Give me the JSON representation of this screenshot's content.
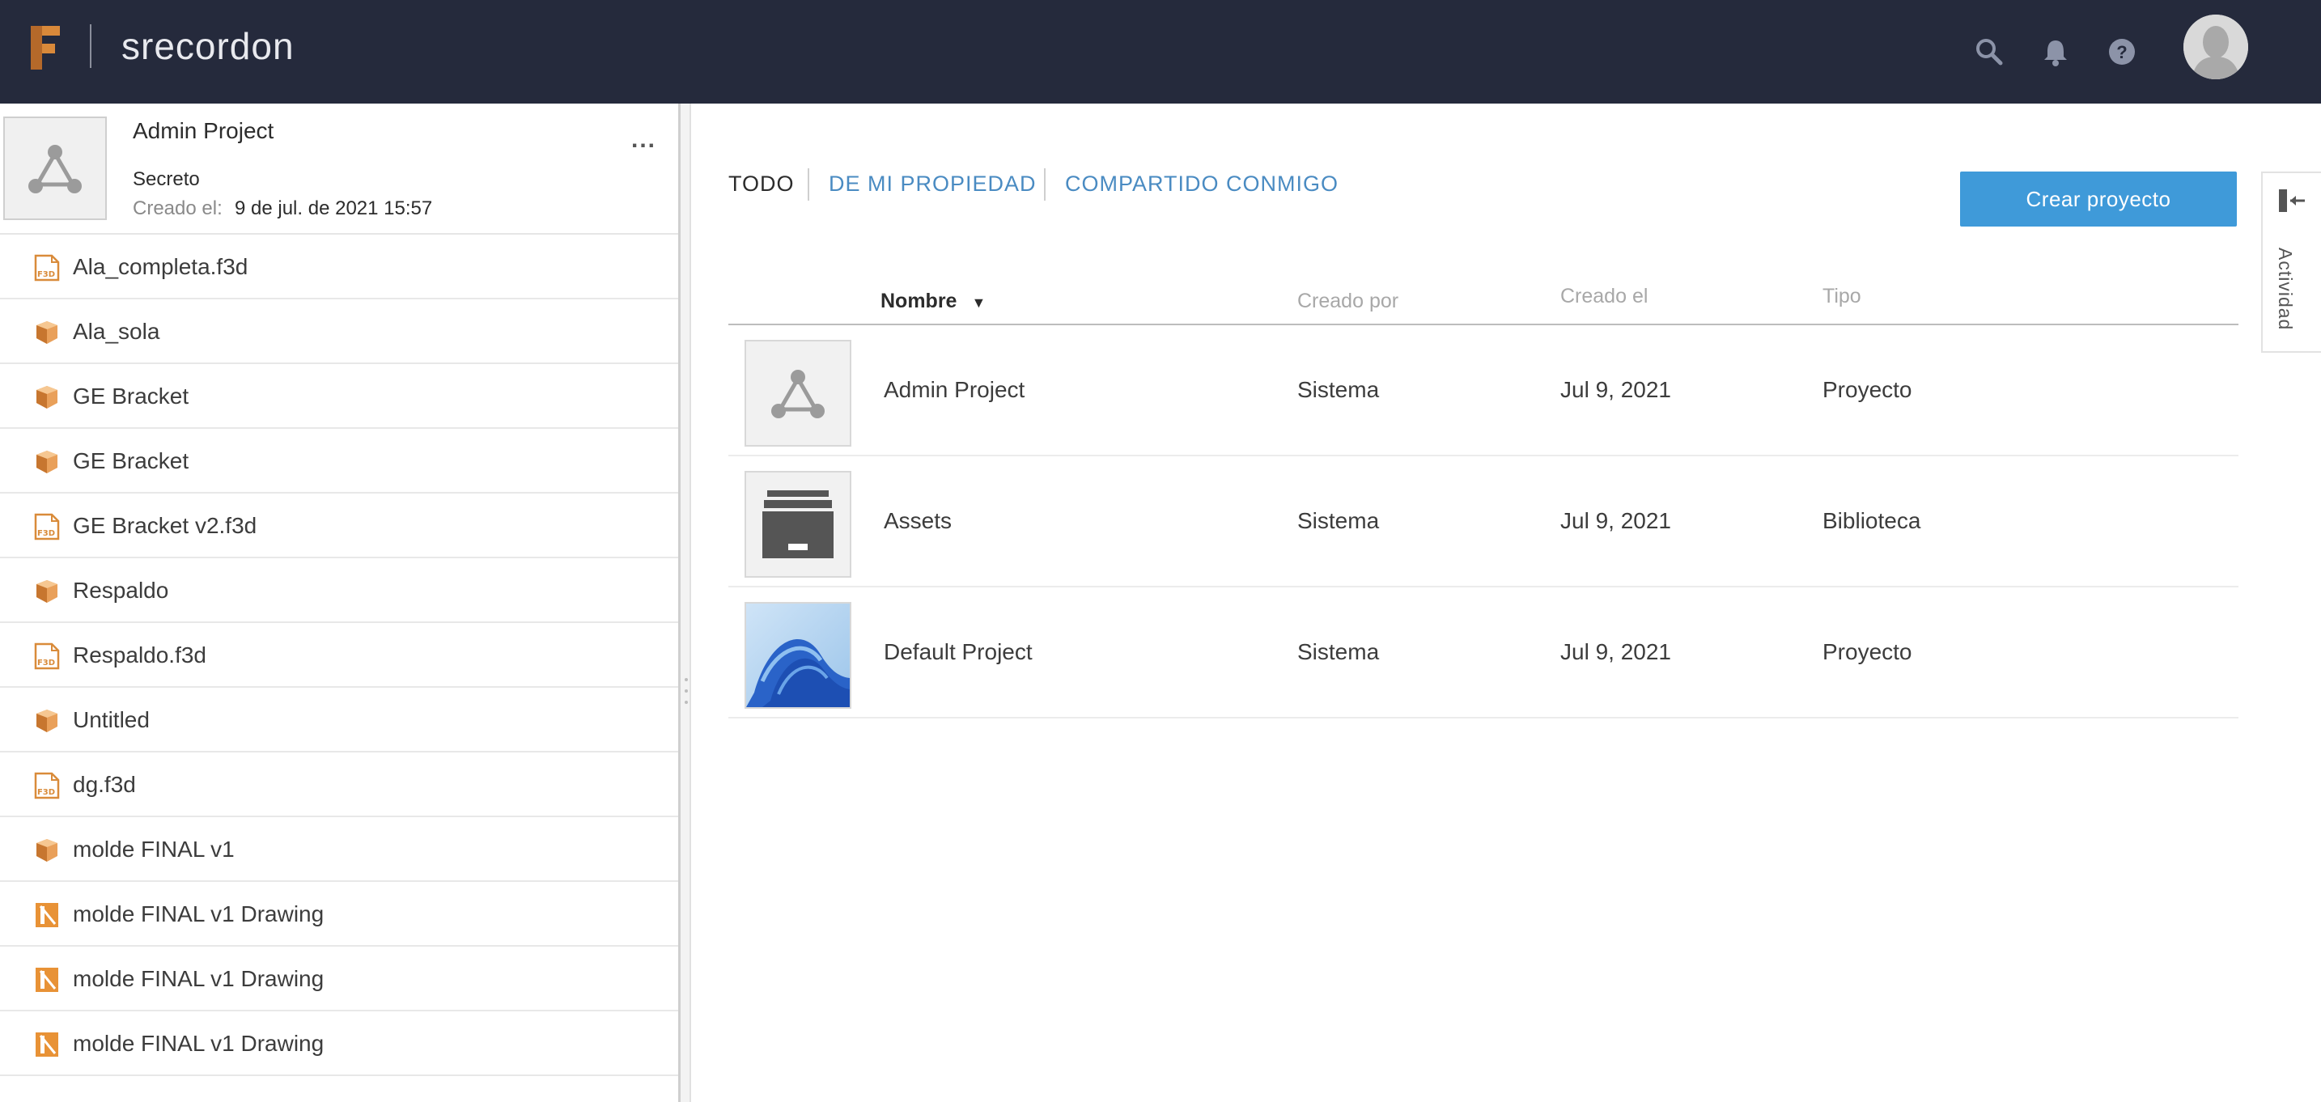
{
  "header": {
    "username": "srecordon",
    "icons": [
      "search-icon",
      "bell-icon",
      "help-icon",
      "avatar"
    ]
  },
  "project_card": {
    "title": "Admin Project",
    "more": "...",
    "visibility": "Secreto",
    "created_label": "Creado el:",
    "created_value": "9 de jul. de 2021 15:57"
  },
  "files": [
    {
      "name": "Ala_completa.f3d",
      "icon": "f3d-file-icon"
    },
    {
      "name": "Ala_sola",
      "icon": "design-icon"
    },
    {
      "name": "GE Bracket",
      "icon": "design-icon"
    },
    {
      "name": "GE Bracket",
      "icon": "design-icon"
    },
    {
      "name": "GE Bracket v2.f3d",
      "icon": "f3d-file-icon"
    },
    {
      "name": "Respaldo",
      "icon": "design-icon"
    },
    {
      "name": "Respaldo.f3d",
      "icon": "f3d-file-icon"
    },
    {
      "name": "Untitled",
      "icon": "design-icon"
    },
    {
      "name": "dg.f3d",
      "icon": "f3d-file-icon"
    },
    {
      "name": "molde FINAL v1",
      "icon": "design-icon"
    },
    {
      "name": "molde FINAL v1 Drawing",
      "icon": "drawing-icon"
    },
    {
      "name": "molde FINAL v1 Drawing",
      "icon": "drawing-icon"
    },
    {
      "name": "molde FINAL v1 Drawing",
      "icon": "drawing-icon"
    }
  ],
  "tabs": [
    {
      "label": "TODO",
      "active": true
    },
    {
      "label": "DE MI PROPIEDAD",
      "active": false
    },
    {
      "label": "COMPARTIDO CONMIGO",
      "active": false
    }
  ],
  "create_button": "Crear proyecto",
  "table": {
    "columns": {
      "name": "Nombre",
      "created_by": "Creado por",
      "created_on": "Creado el",
      "type": "Tipo"
    },
    "rows": [
      {
        "name": "Admin Project",
        "created_by": "Sistema",
        "created_on": "Jul 9, 2021",
        "type": "Proyecto",
        "thumb": "project-network-icon"
      },
      {
        "name": "Assets",
        "created_by": "Sistema",
        "created_on": "Jul 9, 2021",
        "type": "Biblioteca",
        "thumb": "archive-box-icon"
      },
      {
        "name": "Default Project",
        "created_by": "Sistema",
        "created_on": "Jul 9, 2021",
        "type": "Proyecto",
        "thumb": "blue-wave-image"
      }
    ]
  },
  "activity": {
    "label": "Actividad"
  },
  "colors": {
    "header_bg": "#252a3c",
    "accent": "#3f9ad9",
    "link": "#4a8bc2",
    "file_icon": "#d98b3a"
  }
}
